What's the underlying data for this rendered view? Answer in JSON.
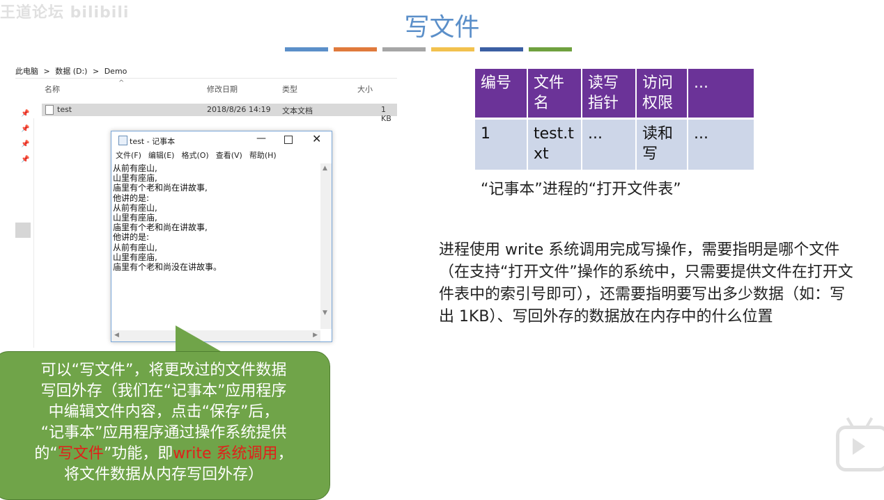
{
  "watermark": "王道论坛 bilibili",
  "slide": {
    "title": "写文件",
    "stripe_colors": [
      "#5b8fc9",
      "#e07a3c",
      "#a6a6a6",
      "#f2c14e",
      "#3b5fa3",
      "#6fa13f"
    ]
  },
  "explorer": {
    "breadcrumb": [
      "此电脑",
      ">",
      "数据 (D:)",
      ">",
      "Demo"
    ],
    "columns": [
      "名称",
      "修改日期",
      "类型",
      "大小"
    ],
    "file": {
      "name": "test",
      "modified": "2018/8/26 14:19",
      "type": "文本文档",
      "size": "1 KB"
    }
  },
  "notepad": {
    "title": "test - 记事本",
    "menu": [
      "文件(F)",
      "编辑(E)",
      "格式(O)",
      "查看(V)",
      "帮助(H)"
    ],
    "content": "从前有座山,\n山里有座庙,\n庙里有个老和尚在讲故事,\n他讲的是:\n从前有座山,\n山里有座庙,\n庙里有个老和尚在讲故事,\n他讲的是:\n从前有座山,\n山里有座庙,\n庙里有个老和尚没在讲故事。"
  },
  "open_file_table": {
    "headers": [
      "编号",
      "文件名",
      "读写指针",
      "访问权限",
      "..."
    ],
    "row": [
      "1",
      "test.txt",
      "...",
      "读和写",
      "..."
    ],
    "caption": "“记事本”进程的“打开文件表”"
  },
  "explanation": "进程使用 write 系统调用完成写操作，需要指明是哪个文件（在支持“打开文件”操作的系统中，只需要提供文件在打开文件表中的索引号即可），还需要指明要写出多少数据（如：写出 1KB）、写回外存的数据放在内存中的什么位置",
  "callout": {
    "line1": "可以“写文件”，将更改过的文件数据",
    "line2": "写回外存（我们在“记事本”应用程序",
    "line3": "中编辑文件内容，点击“保存”后，",
    "line4": "“记事本”应用程序通过操作系统提供",
    "line5_a": "的“",
    "line5_red1": "写文件",
    "line5_b": "”功能，即",
    "line5_red2": "write 系统调用",
    "line5_c": "，",
    "line6": "将文件数据从内存写回外存）"
  }
}
